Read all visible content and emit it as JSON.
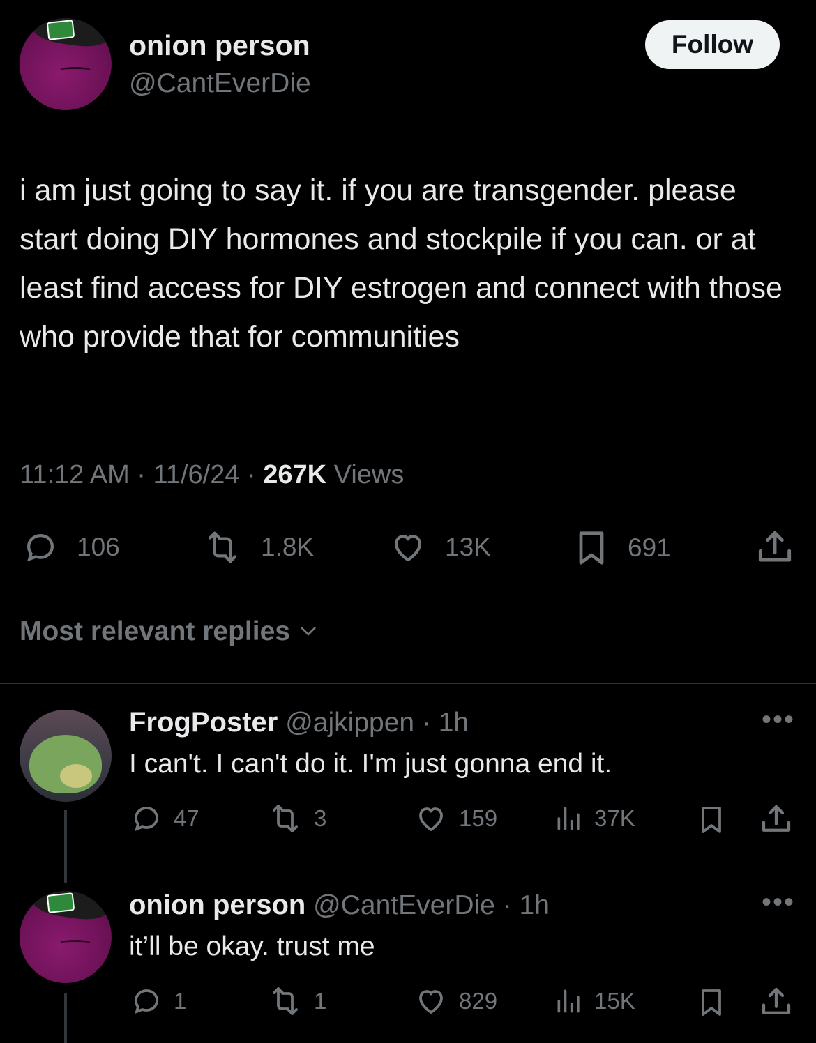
{
  "tweet": {
    "author_name": "onion person",
    "author_handle": "@CantEverDie",
    "follow_label": "Follow",
    "text": "i am just going to say it.  if you are transgender. please start doing DIY hormones and stockpile if you can.  or at least find access for DIY estrogen and connect with those who provide that for communities",
    "time": "11:12 AM",
    "date": "11/6/24",
    "views_count": "267K",
    "views_label": "Views",
    "separator": "·",
    "stats": {
      "replies": "106",
      "reposts": "1.8K",
      "likes": "13K",
      "bookmarks": "691"
    }
  },
  "replies_filter": {
    "label": "Most relevant replies"
  },
  "replies": [
    {
      "author_name": "FrogPoster",
      "author_handle": "@ajkippen",
      "age": "· 1h",
      "text": "I can't.  I can't do it. I'm just gonna end it.",
      "replies": "47",
      "reposts": "3",
      "likes": "159",
      "views": "37K"
    },
    {
      "author_name": "onion person",
      "author_handle": "@CantEverDie",
      "age": "· 1h",
      "text": "it’ll be okay.  trust me",
      "replies": "1",
      "reposts": "1",
      "likes": "829",
      "views": "15K"
    }
  ],
  "icons": {
    "reply": "speech-bubble-icon",
    "repost": "repost-arrows-icon",
    "like": "heart-icon",
    "bookmark": "bookmark-icon",
    "share": "share-upload-icon",
    "views": "bar-chart-icon",
    "more": "ellipsis-icon",
    "chevron": "chevron-down-icon"
  },
  "colors": {
    "background": "#000000",
    "primary_text": "#e7e9ea",
    "secondary_text": "#71767b",
    "follow_button_bg": "#eff3f4"
  }
}
